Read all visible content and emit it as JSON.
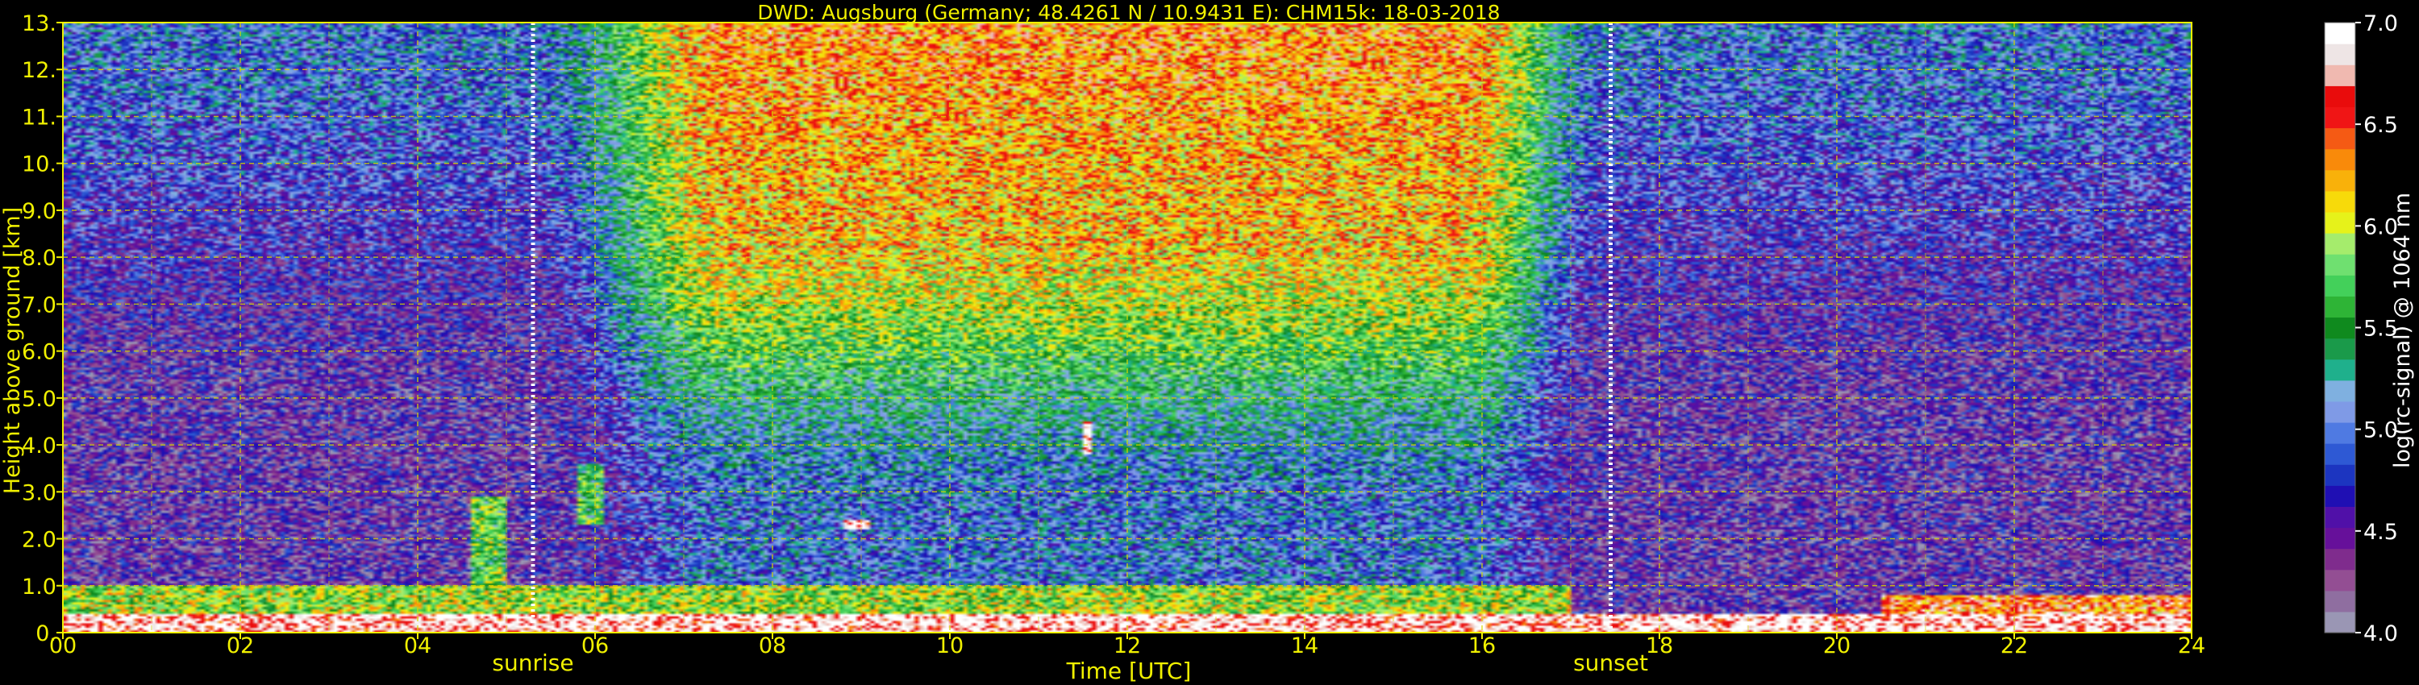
{
  "chart_data": {
    "type": "heatmap",
    "title": "DWD: Augsburg (Germany; 48.4261 N / 10.9431 E):    CHM15k: 18-03-2018",
    "xlabel": "Time [UTC]",
    "ylabel": "Height above ground [km]",
    "xlim": [
      0,
      24
    ],
    "ylim": [
      0,
      13
    ],
    "x_ticks": [
      "00",
      "02",
      "04",
      "06",
      "08",
      "10",
      "12",
      "14",
      "16",
      "18",
      "20",
      "22",
      "24"
    ],
    "y_ticks": [
      "0.",
      "1.0",
      "2.0",
      "3.0",
      "4.0",
      "5.0",
      "6.0",
      "7.0",
      "8.0",
      "9.0",
      "10.",
      "11.",
      "12.",
      "13."
    ],
    "grid": true,
    "annotations": [
      {
        "label": "sunrise",
        "time_utc": 5.3
      },
      {
        "label": "sunset",
        "time_utc": 17.45
      }
    ],
    "colorbar": {
      "label": "log(rc-signal) @ 1064 nm",
      "min": 4.0,
      "max": 7.0,
      "ticks": [
        "4.0",
        "4.5",
        "5.0",
        "5.5",
        "6.0",
        "6.5",
        "7.0"
      ],
      "colors": [
        "#9a96b4",
        "#8f6ea0",
        "#934e93",
        "#7f2c8d",
        "#66109a",
        "#5010a8",
        "#1f0fb3",
        "#1c35c0",
        "#2e59d4",
        "#4f7ae2",
        "#7f9ae6",
        "#7fb0e0",
        "#1fb08c",
        "#1a9a4a",
        "#0f8a1e",
        "#2eb436",
        "#43d05a",
        "#6fe070",
        "#a5ec6c",
        "#e6f21a",
        "#f7da0a",
        "#f9b10a",
        "#f98a0a",
        "#f55a14",
        "#f01515",
        "#e90c0c",
        "#f0b9b0",
        "#eee5e5",
        "#ffffff"
      ]
    },
    "features": [
      {
        "name": "surface aerosol layer",
        "time_range": [
          0,
          24
        ],
        "height_km": [
          0,
          0.4
        ],
        "log_signal": 7.0
      },
      {
        "name": "boundary layer aerosol",
        "time_range": [
          0,
          17
        ],
        "height_km": [
          0.4,
          1.0
        ],
        "log_signal": 6.0
      },
      {
        "name": "aerosol plume",
        "time_range": [
          4.6,
          5.0
        ],
        "height_km": [
          1.0,
          2.9
        ],
        "log_signal": 5.8
      },
      {
        "name": "aerosol plume",
        "time_range": [
          5.8,
          6.1
        ],
        "height_km": [
          2.3,
          3.6
        ],
        "log_signal": 5.7
      },
      {
        "name": "cloud",
        "time_range": [
          11.52,
          11.62
        ],
        "height_km": [
          3.8,
          4.5
        ],
        "log_signal": 7.0
      },
      {
        "name": "cloud",
        "time_range": [
          8.8,
          9.1
        ],
        "height_km": [
          2.2,
          2.4
        ],
        "log_signal": 7.0
      },
      {
        "name": "daytime background noise",
        "time_range": [
          5.5,
          17.2
        ],
        "height_km": [
          3.0,
          13.0
        ],
        "log_signal": 6.2
      },
      {
        "name": "residual layer",
        "time_range": [
          20.5,
          24
        ],
        "height_km": [
          0.1,
          0.8
        ],
        "log_signal": 6.6
      }
    ]
  }
}
